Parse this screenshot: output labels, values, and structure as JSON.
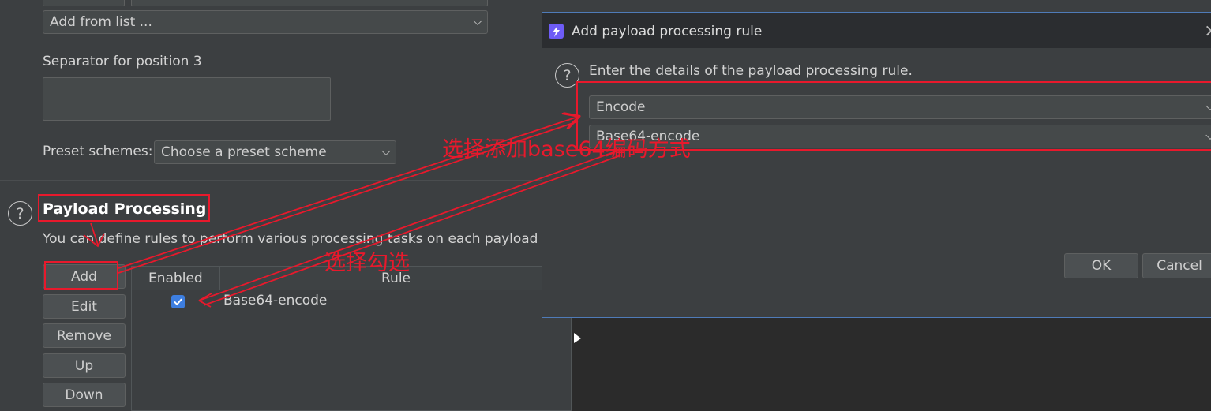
{
  "left_panel": {
    "add_from_list": "Add from list ...",
    "separator_label": "Separator for position 3",
    "preset_label": "Preset schemes:",
    "preset_value": "Choose a preset scheme",
    "section_title": "Payload Processing",
    "section_desc": "You can define rules to perform various processing tasks on each payload",
    "buttons": {
      "add": "Add",
      "edit": "Edit",
      "remove": "Remove",
      "up": "Up",
      "down": "Down"
    },
    "table": {
      "headers": [
        "Enabled",
        "Rule"
      ],
      "rows": [
        {
          "enabled": true,
          "rule": "Base64-encode"
        }
      ]
    }
  },
  "dialog": {
    "title": "Add payload processing rule",
    "close": "×",
    "help_text": "Enter the details of the payload processing rule.",
    "rule_type": "Encode",
    "rule_value": "Base64-encode",
    "ok": "OK",
    "cancel": "Cancel"
  },
  "annotations": {
    "choose_base64": "选择添加base64编码方式",
    "choose_check": "选择勾选"
  },
  "colors": {
    "background": "#3c3f41",
    "annotation_red": "#e8192c",
    "checkbox_blue": "#3d7ee0",
    "dialog_icon": "#6e5cf6"
  }
}
